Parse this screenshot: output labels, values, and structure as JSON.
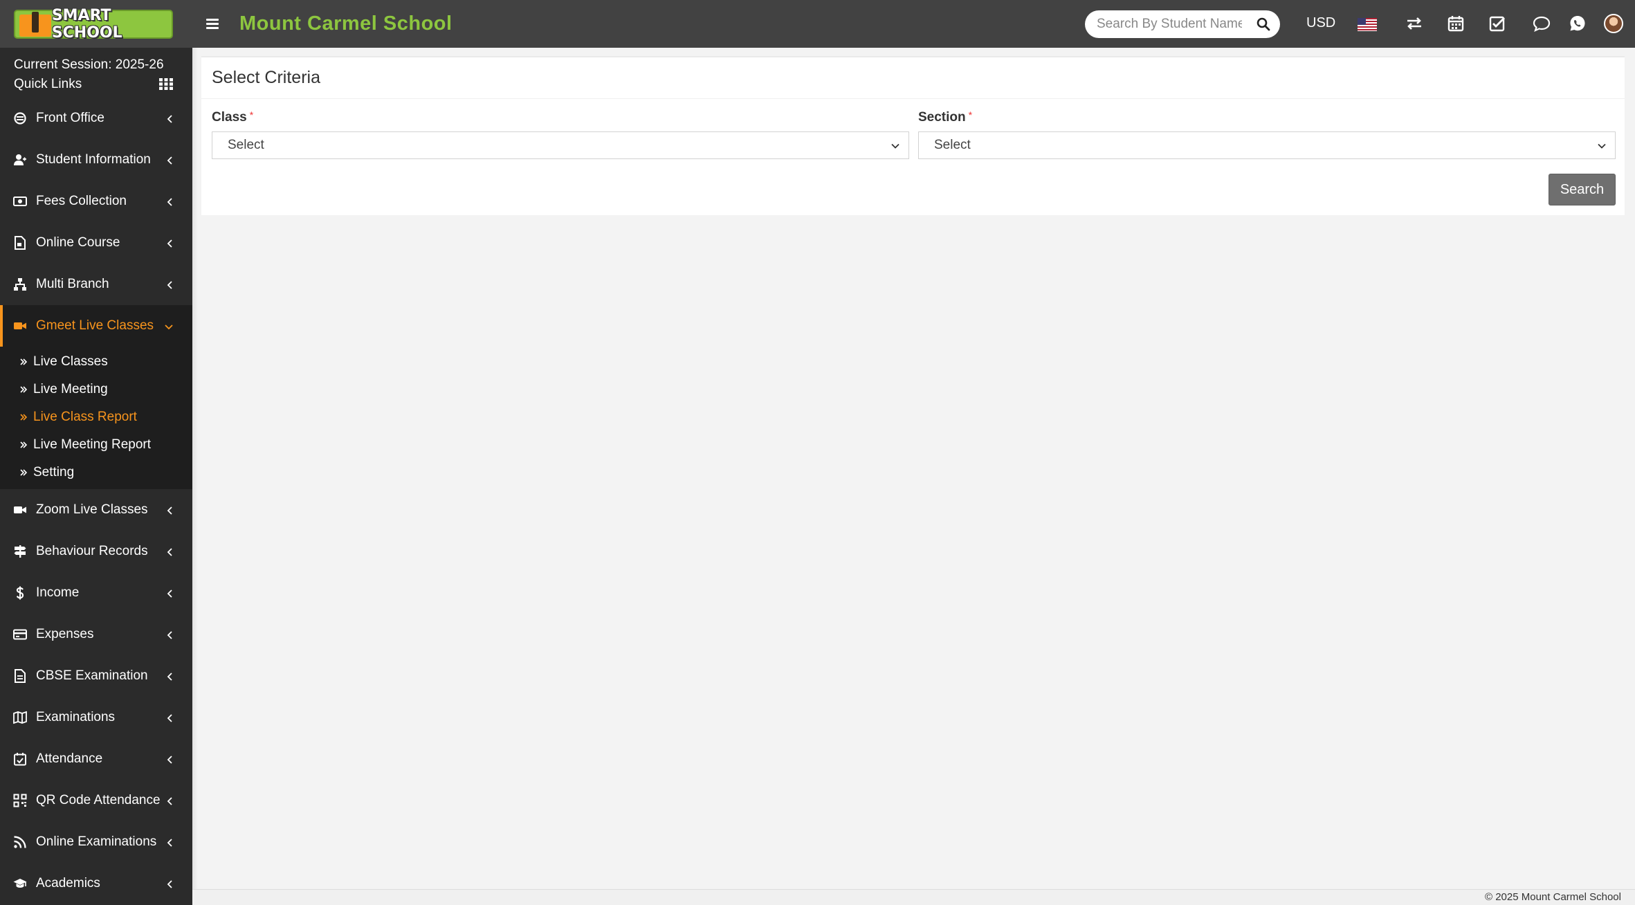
{
  "app": {
    "logo_text": "SMART SCHOOL",
    "school_name": "Mount Carmel School",
    "brand_green": "#8dc63f",
    "accent_orange": "#f7941d"
  },
  "topbar": {
    "search_placeholder": "Search By Student Name",
    "currency": "USD",
    "icons": [
      "flag-us-icon",
      "switch-icon",
      "calendar-icon",
      "tasks-icon",
      "chat-icon",
      "whatsapp-icon",
      "avatar"
    ]
  },
  "sidebar": {
    "session": "Current Session: 2025-26",
    "quick_links": "Quick Links",
    "items_top": [
      {
        "label": "Front Office",
        "icon": "front-office-icon"
      },
      {
        "label": "Student Information",
        "icon": "student-icon"
      },
      {
        "label": "Fees Collection",
        "icon": "money-icon"
      },
      {
        "label": "Online Course",
        "icon": "course-icon"
      },
      {
        "label": "Multi Branch",
        "icon": "branch-icon"
      }
    ],
    "active_item": {
      "label": "Gmeet Live Classes",
      "icon": "video-icon"
    },
    "submenu": [
      {
        "label": "Live Classes"
      },
      {
        "label": "Live Meeting"
      },
      {
        "label": "Live Class Report"
      },
      {
        "label": "Live Meeting Report"
      },
      {
        "label": "Setting"
      }
    ],
    "items_bottom": [
      {
        "label": "Zoom Live Classes",
        "icon": "video-icon"
      },
      {
        "label": "Behaviour Records",
        "icon": "signpost-icon"
      },
      {
        "label": "Income",
        "icon": "dollar-icon"
      },
      {
        "label": "Expenses",
        "icon": "credit-card-icon"
      },
      {
        "label": "CBSE Examination",
        "icon": "document-icon"
      },
      {
        "label": "Examinations",
        "icon": "map-icon"
      },
      {
        "label": "Attendance",
        "icon": "calendar-check-icon"
      },
      {
        "label": "QR Code Attendance",
        "icon": "qrcode-icon"
      },
      {
        "label": "Online Examinations",
        "icon": "rss-icon"
      },
      {
        "label": "Academics",
        "icon": "graduation-cap-icon"
      }
    ]
  },
  "main": {
    "panel_title": "Select Criteria",
    "class_label": "Class",
    "section_label": "Section",
    "required_mark": "*",
    "class_value": "Select",
    "section_value": "Select",
    "search_button": "Search"
  },
  "footer": {
    "text": "© 2025 Mount Carmel School"
  }
}
